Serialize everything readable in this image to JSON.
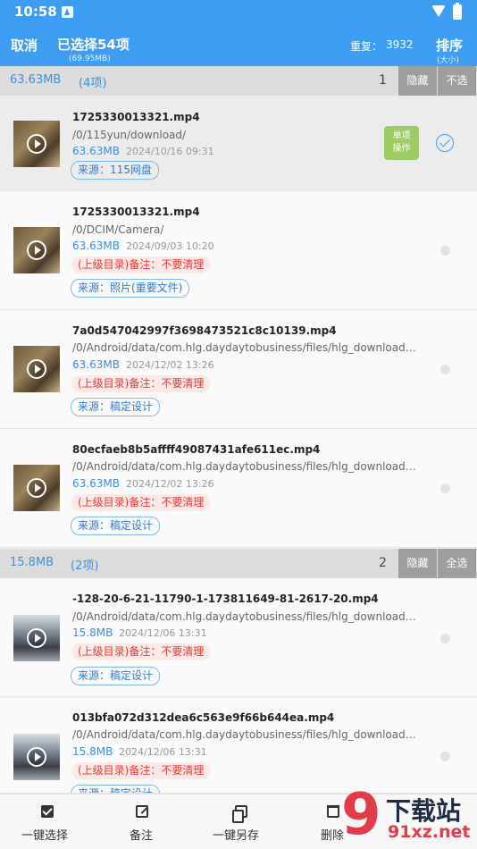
{
  "status_bar": {
    "time": "10:58"
  },
  "app_bar": {
    "cancel": "取消",
    "title": "已选择54项",
    "subtitle": "(69.95MB)",
    "duplicate_label": "重复：",
    "duplicate_count": "3932",
    "sort": "排序",
    "sort_sub": "(大小)"
  },
  "groups": [
    {
      "size": "63.63MB",
      "count": "(4项)",
      "index": "1",
      "hide": "隐藏",
      "select": "不选",
      "files": [
        {
          "name": "1725330013321.mp4",
          "path": "/0/115yun/download/",
          "size": "63.63MB",
          "date": "2024/10/16 09:31",
          "source": "来源：115网盘",
          "single_op": "单项\n操作",
          "selected": true
        },
        {
          "name": "1725330013321.mp4",
          "path": "/0/DCIM/Camera/",
          "size": "63.63MB",
          "date": "2024/09/03 10:20",
          "note": "(上级目录)备注：不要清理",
          "source": "来源：照片(重要文件)"
        },
        {
          "name": "7a0d547042997f3698473521c8c10139.mp4",
          "path": "/0/Android/data/com.hlg.daydaytobusiness/files/hlg_download/G...",
          "size": "63.63MB",
          "date": "2024/12/02 13:26",
          "note": "(上级目录)备注：不要清理",
          "source": "来源：稿定设计"
        },
        {
          "name": "80ecfaeb8b5affff49087431afe611ec.mp4",
          "path": "/0/Android/data/com.hlg.daydaytobusiness/files/hlg_download/vi...",
          "size": "63.63MB",
          "date": "2024/12/02 13:26",
          "note": "(上级目录)备注：不要清理",
          "source": "来源：稿定设计"
        }
      ]
    },
    {
      "size": "15.8MB",
      "count": "(2项)",
      "index": "2",
      "hide": "隐藏",
      "select": "全选",
      "files": [
        {
          "name": "-128-20-6-21-11790-1-173811649-81-2617-20.mp4",
          "path": "/0/Android/data/com.hlg.daydaytobusiness/files/hlg_download/vi...",
          "size": "15.8MB",
          "date": "2024/12/06 13:31",
          "note": "(上级目录)备注：不要清理",
          "source": "来源：稿定设计"
        },
        {
          "name": "013bfa072d312dea6c563e9f66b644ea.mp4",
          "path": "/0/Android/data/com.hlg.daydaytobusiness/files/hlg_download/G...",
          "size": "15.8MB",
          "date": "2024/12/06 13:31",
          "note": "(上级目录)备注：不要清理",
          "source": "来源：稿定设计"
        }
      ]
    }
  ],
  "bottom_bar": {
    "select_all": "一键选择",
    "note": "备注",
    "save_as": "一键另存",
    "delete": "删除"
  },
  "watermark": {
    "top": "下载站",
    "bottom": "91xz.net",
    "nine": "9"
  },
  "colors": {
    "primary": "#3d9df3",
    "note_red": "#e53935",
    "single_op_green": "#9ccc65"
  }
}
